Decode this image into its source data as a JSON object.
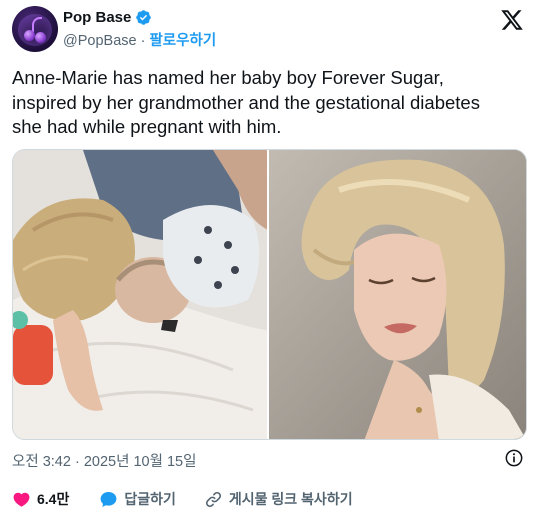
{
  "author": {
    "display_name": "Pop Base",
    "handle": "@PopBase",
    "separator": " · ",
    "follow_label": "팔로우하기"
  },
  "tweet": {
    "text": "Anne-Marie has named her baby boy Forever Sugar,\ninspired by her grandmother and the gestational diabetes\nshe had while pregnant with him."
  },
  "media": {
    "count": 2
  },
  "meta": {
    "timestamp": "오전 3:42 · 2025년 10월 15일"
  },
  "actions": {
    "like_count": "6.4만",
    "reply_label": "답글하기",
    "copy_label": "게시물 링크 복사하기"
  },
  "colors": {
    "accent": "#1d9bf0",
    "like": "#f91880",
    "secondary_text": "#536471",
    "primary_text": "#0f1419",
    "border": "#cfd9de"
  },
  "icons": [
    "verified-badge-icon",
    "x-logo-icon",
    "info-icon",
    "heart-icon",
    "reply-bubble-icon",
    "link-icon"
  ]
}
